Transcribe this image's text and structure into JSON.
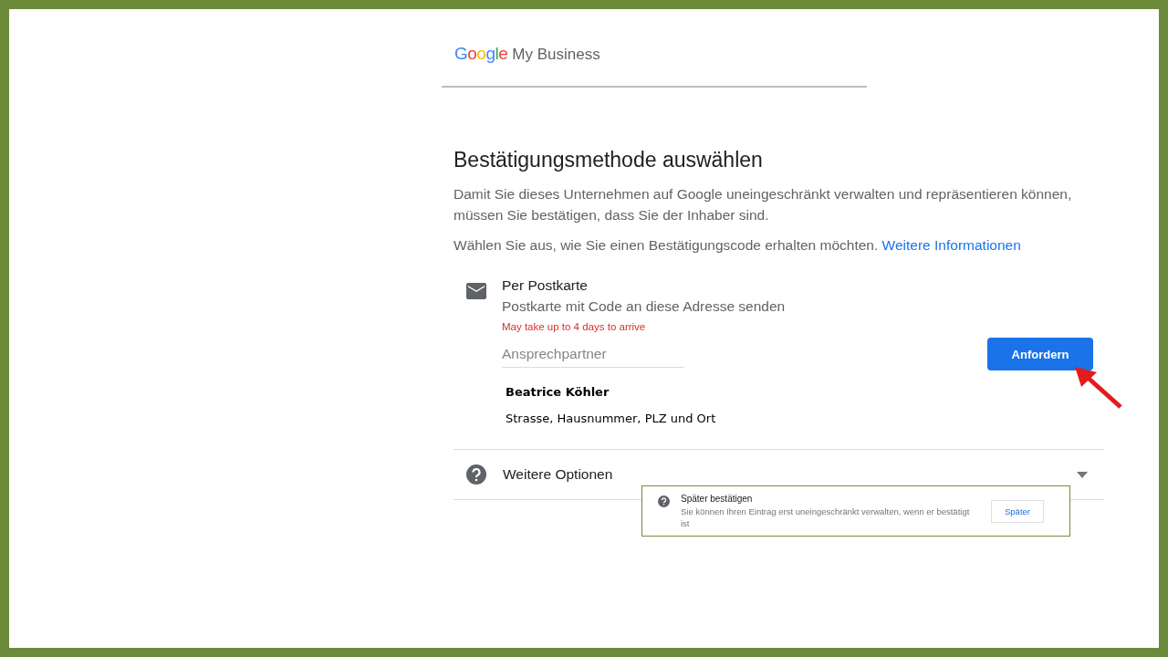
{
  "header": {
    "logo_word": "Google",
    "product": "My Business"
  },
  "title": "Bestätigungsmethode auswählen",
  "intro": "Damit Sie dieses Unternehmen auf Google uneingeschränkt verwalten und repräsentieren können, müssen Sie bestätigen, dass Sie der Inhaber sind.",
  "choose_text": "Wählen Sie aus, wie Sie einen Bestätigungscode erhalten möchten.",
  "more_info_link": "Weitere Informationen",
  "postcard": {
    "title": "Per Postkarte",
    "subtitle": "Postkarte mit Code an diese Adresse senden",
    "note": "May take up to 4 days to arrive",
    "contact_field": {
      "placeholder": "Ansprechpartner"
    },
    "name": "Beatrice Köhler",
    "address": "Strasse, Hausnummer, PLZ und Ort",
    "button": "Anfordern"
  },
  "more_options": {
    "label": "Weitere Optionen",
    "expanded": false
  },
  "later_popup": {
    "title": "Später bestätigen",
    "text": "Sie können Ihren Eintrag erst uneingeschränkt verwalten, wenn er bestätigt ist",
    "button": "Später"
  }
}
